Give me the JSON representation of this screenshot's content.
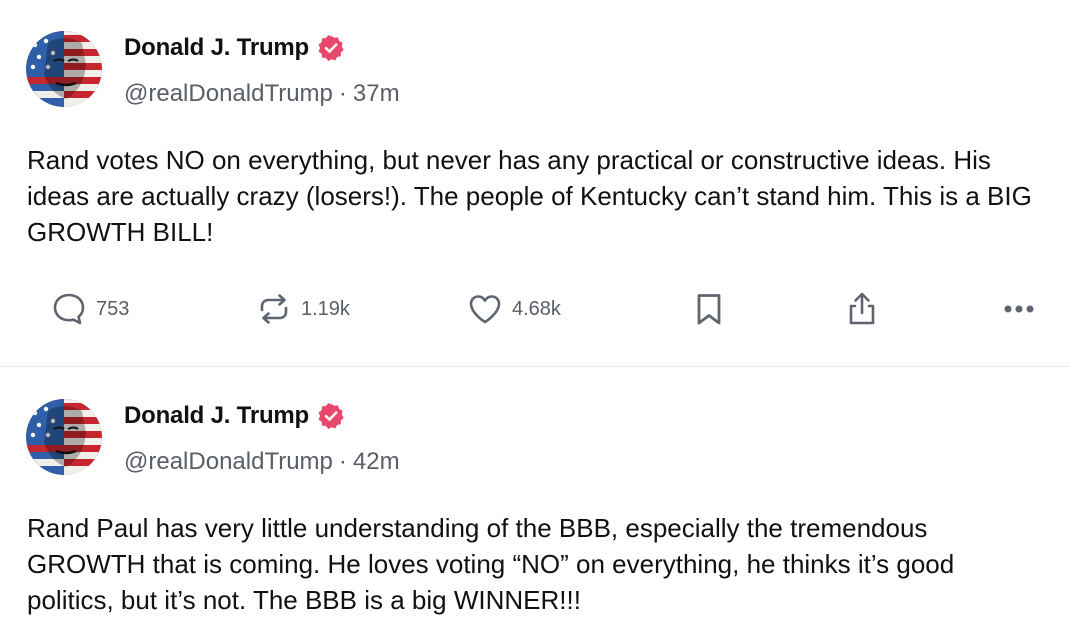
{
  "posts": [
    {
      "author": {
        "name": "Donald J. Trump",
        "handle": "@realDonaldTrump",
        "separator": "·",
        "time": "37m",
        "verified": true,
        "avatar_icon": "avatar-flag-portrait"
      },
      "text": "Rand votes NO on everything, but never has any practical or constructive ideas. His ideas are actually crazy (losers!). The people of Kentucky can’t stand him. This is a BIG GROWTH BILL!",
      "stats": {
        "replies": "753",
        "retruths": "1.19k",
        "likes": "4.68k"
      }
    },
    {
      "author": {
        "name": "Donald J. Trump",
        "handle": "@realDonaldTrump",
        "separator": "·",
        "time": "42m",
        "verified": true,
        "avatar_icon": "avatar-flag-portrait"
      },
      "text": "Rand Paul has very little understanding of the BBB, especially the tremendous GROWTH that is coming. He loves voting “NO” on everything, he thinks it’s good politics, but it’s not. The BBB is a big WINNER!!!"
    }
  ],
  "icons": {
    "verified": "verified-badge-icon",
    "reply": "speech-bubble-icon",
    "retruth": "repost-arrows-icon",
    "like": "heart-icon",
    "bookmark": "bookmark-icon",
    "share": "share-icon",
    "more": "more-dots-icon"
  },
  "colors": {
    "verified": "#e8476a",
    "muted_text": "#595e66",
    "icon": "#5f6570",
    "divider": "#e6e6e6"
  }
}
